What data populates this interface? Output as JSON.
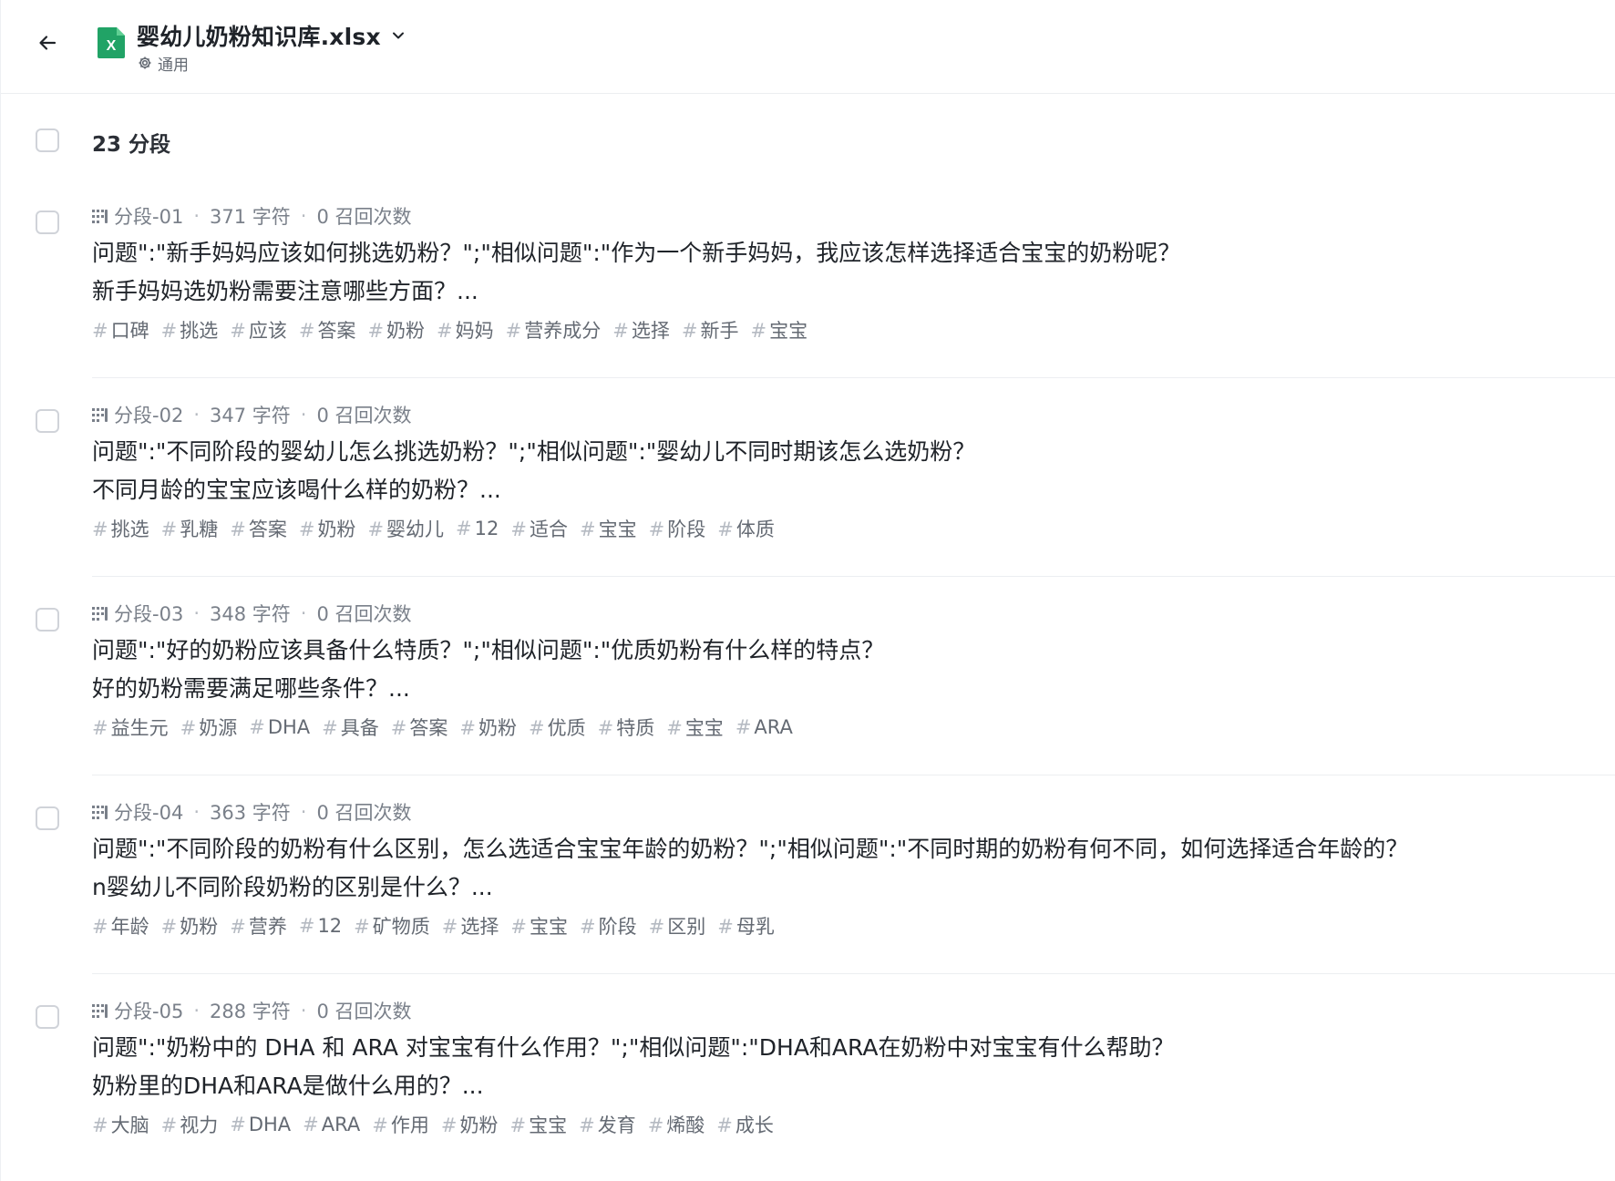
{
  "header": {
    "title": "婴幼儿奶粉知识库.xlsx",
    "mode_label": "通用",
    "file_icon_letter": "X",
    "file_icon_color": "#21a366"
  },
  "summary": {
    "count_label": "23 分段"
  },
  "segments": [
    {
      "id": "分段-01",
      "chars": "371 字符",
      "recalls": "0 召回次数",
      "line1": "问题\":\"新手妈妈应该如何挑选奶粉？\";\"相似问题\":\"作为一个新手妈妈，我应该怎样选择适合宝宝的奶粉呢？",
      "line2": "新手妈妈选奶粉需要注意哪些方面？...",
      "tags": [
        "口碑",
        "挑选",
        "应该",
        "答案",
        "奶粉",
        "妈妈",
        "营养成分",
        "选择",
        "新手",
        "宝宝"
      ]
    },
    {
      "id": "分段-02",
      "chars": "347 字符",
      "recalls": "0 召回次数",
      "line1": "问题\":\"不同阶段的婴幼儿怎么挑选奶粉？\";\"相似问题\":\"婴幼儿不同时期该怎么选奶粉？",
      "line2": "不同月龄的宝宝应该喝什么样的奶粉？...",
      "tags": [
        "挑选",
        "乳糖",
        "答案",
        "奶粉",
        "婴幼儿",
        "12",
        "适合",
        "宝宝",
        "阶段",
        "体质"
      ]
    },
    {
      "id": "分段-03",
      "chars": "348 字符",
      "recalls": "0 召回次数",
      "line1": "问题\":\"好的奶粉应该具备什么特质？\";\"相似问题\":\"优质奶粉有什么样的特点？",
      "line2": "好的奶粉需要满足哪些条件？...",
      "tags": [
        "益生元",
        "奶源",
        "DHA",
        "具备",
        "答案",
        "奶粉",
        "优质",
        "特质",
        "宝宝",
        "ARA"
      ]
    },
    {
      "id": "分段-04",
      "chars": "363 字符",
      "recalls": "0 召回次数",
      "line1": "问题\":\"不同阶段的奶粉有什么区别，怎么选适合宝宝年龄的奶粉？\";\"相似问题\":\"不同时期的奶粉有何不同，如何选择适合年龄的？",
      "line2": "n婴幼儿不同阶段奶粉的区别是什么？...",
      "tags": [
        "年龄",
        "奶粉",
        "营养",
        "12",
        "矿物质",
        "选择",
        "宝宝",
        "阶段",
        "区别",
        "母乳"
      ]
    },
    {
      "id": "分段-05",
      "chars": "288 字符",
      "recalls": "0 召回次数",
      "line1": "问题\":\"奶粉中的 DHA 和 ARA 对宝宝有什么作用？\";\"相似问题\":\"DHA和ARA在奶粉中对宝宝有什么帮助？",
      "line2": "奶粉里的DHA和ARA是做什么用的？...",
      "tags": [
        "大脑",
        "视力",
        "DHA",
        "ARA",
        "作用",
        "奶粉",
        "宝宝",
        "发育",
        "烯酸",
        "成长"
      ]
    }
  ]
}
